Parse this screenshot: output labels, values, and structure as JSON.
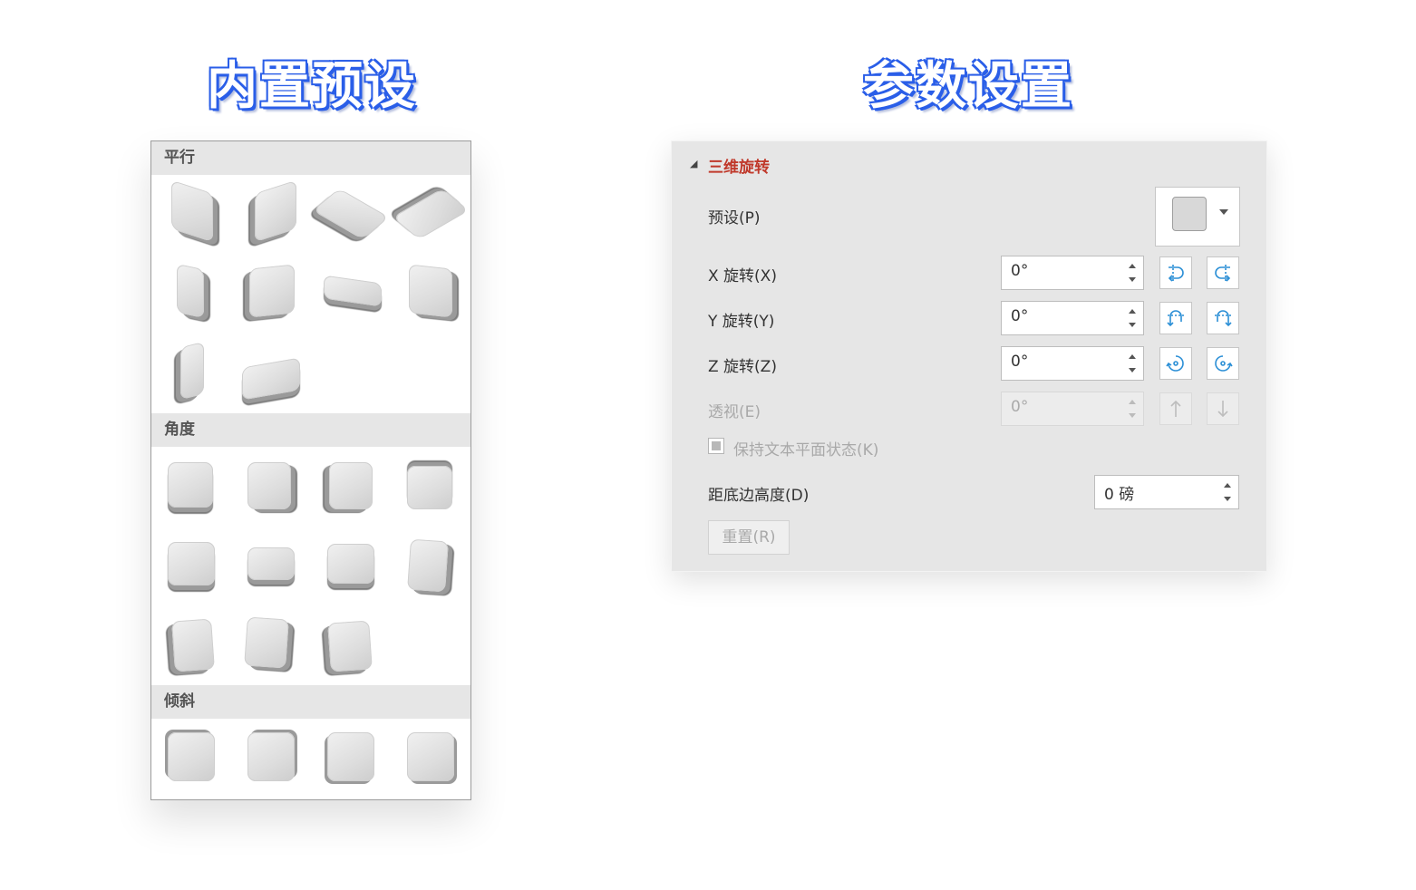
{
  "headings": {
    "left": "内置预设",
    "right": "参数设置"
  },
  "gallery": {
    "sections": [
      {
        "label": "平行"
      },
      {
        "label": "角度"
      },
      {
        "label": "倾斜"
      }
    ]
  },
  "panel": {
    "title": "三维旋转",
    "preset_label": "预设(P)",
    "x_label": "X 旋转(X)",
    "x_value": "0°",
    "y_label": "Y 旋转(Y)",
    "y_value": "0°",
    "z_label": "Z 旋转(Z)",
    "z_value": "0°",
    "perspective_label": "透视(E)",
    "perspective_value": "0°",
    "keep_text_flat_label": "保持文本平面状态(K)",
    "distance_label": "距底边高度(D)",
    "distance_value": "0 磅",
    "reset_label": "重置(R)"
  },
  "colors": {
    "accent_title": "#c0392b",
    "icon_blue": "#2b8fd6",
    "heading_blue": "#2a5ee8"
  },
  "icons": [
    "x-rotate-left-icon",
    "x-rotate-right-icon",
    "y-rotate-up-icon",
    "y-rotate-down-icon",
    "z-rotate-ccw-icon",
    "z-rotate-cw-icon",
    "perspective-up-icon",
    "perspective-down-icon"
  ]
}
